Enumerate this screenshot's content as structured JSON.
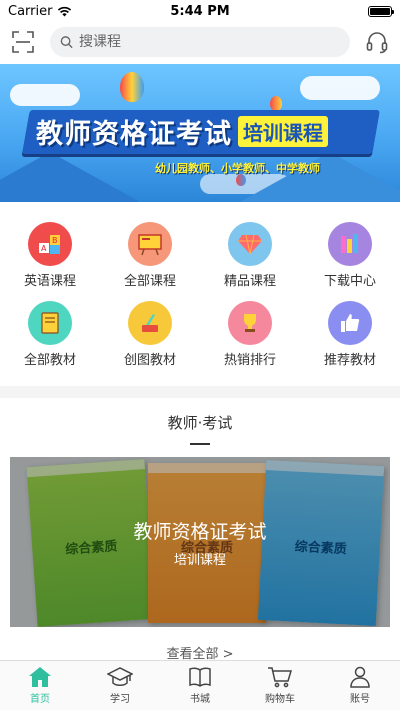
{
  "status_bar": {
    "carrier": "Carrier",
    "time": "5:44 PM"
  },
  "search": {
    "placeholder": "搜课程"
  },
  "banner": {
    "title": "教师资格证考试",
    "tag": "培训课程",
    "subtitle": "幼儿园教师、小学教师、中学教师"
  },
  "grid": [
    {
      "label": "英语课程",
      "color": "#f04c4c",
      "icon": "abc-blocks-icon"
    },
    {
      "label": "全部课程",
      "color": "#f7977a",
      "icon": "blackboard-icon"
    },
    {
      "label": "精品课程",
      "color": "#7fc6ef",
      "icon": "diamond-icon"
    },
    {
      "label": "下载中心",
      "color": "#a685e0",
      "icon": "books-download-icon"
    },
    {
      "label": "全部教材",
      "color": "#4fd6c0",
      "icon": "book-icon"
    },
    {
      "label": "创图教材",
      "color": "#f7c93a",
      "icon": "ink-pen-icon"
    },
    {
      "label": "热销排行",
      "color": "#f5889c",
      "icon": "trophy-icon"
    },
    {
      "label": "推荐教材",
      "color": "#8a8ef0",
      "icon": "thumbs-up-icon"
    }
  ],
  "section": {
    "title": "教师·考试"
  },
  "course_card": {
    "title": "教师资格证考试",
    "subtitle": "培训课程",
    "book_titles": [
      "综合素质",
      "综合素质",
      "综合素质"
    ]
  },
  "view_all": "查看全部 >",
  "tabs": [
    {
      "label": "首页",
      "icon": "home-icon",
      "active": true
    },
    {
      "label": "学习",
      "icon": "graduation-cap-icon",
      "active": false
    },
    {
      "label": "书城",
      "icon": "open-book-icon",
      "active": false
    },
    {
      "label": "购物车",
      "icon": "cart-icon",
      "active": false
    },
    {
      "label": "账号",
      "icon": "user-icon",
      "active": false
    }
  ],
  "colors": {
    "accent": "#2fbf9f",
    "banner_blue": "#1f5fc4",
    "banner_yellow": "#fff23b"
  }
}
